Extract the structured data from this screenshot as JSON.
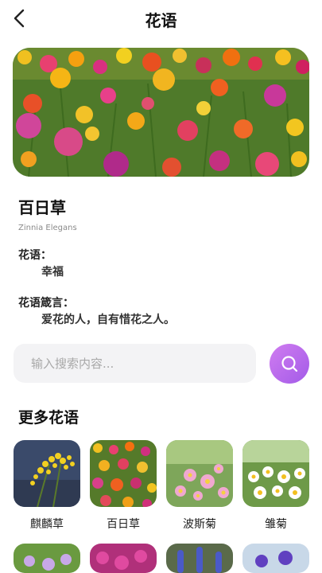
{
  "header": {
    "title": "花语"
  },
  "flower": {
    "name": "百日草",
    "latin": "Zinnia Elegans",
    "language_label": "花语：",
    "language_value": "幸福",
    "quote_label": "花语箴言：",
    "quote_value": "爱花的人，自有惜花之人。"
  },
  "search": {
    "placeholder": "输入搜索内容..."
  },
  "more": {
    "title": "更多花语",
    "items": [
      {
        "label": "麒麟草"
      },
      {
        "label": "百日草"
      },
      {
        "label": "波斯菊"
      },
      {
        "label": "雏菊"
      }
    ]
  },
  "colors": {
    "accent_start": "#d07cf0",
    "accent_end": "#a35be8"
  }
}
